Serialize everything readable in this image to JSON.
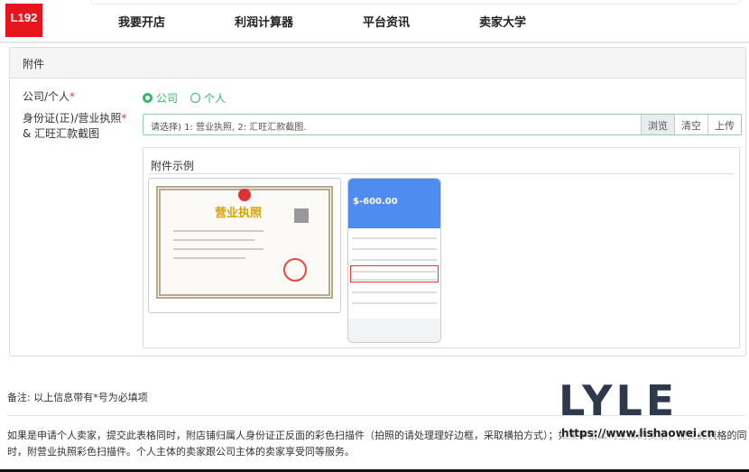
{
  "logo": {
    "text": "L192"
  },
  "nav": [
    "我要开店",
    "利润计算器",
    "平台资讯",
    "卖家大学"
  ],
  "panel": {
    "title": "附件"
  },
  "form": {
    "type_label": "公司/个人",
    "type_options": [
      "公司",
      "个人"
    ],
    "type_selected": "公司",
    "file_label_1": "身份证(正)/营业执照",
    "file_label_2": "& 汇旺汇款截图",
    "file_placeholder": "请选择) 1: 营业执照, 2: 汇旺汇款截图.",
    "browse": "浏览",
    "clear": "清空",
    "upload": "上传",
    "required_mark": "*"
  },
  "example": {
    "title": "附件示例",
    "cert_title": "营业执照",
    "phone_amount": "$-600.00"
  },
  "note": "备注: 以上信息带有*号为必填项",
  "paragraph": "如果是申请个人卖家，提交此表格同时，附店铺归属人身份证正反面的彩色扫描件（拍照的请处理理好边框，采取横拍方式）；如果申请公司主体的卖家，提交此表格的同时，附营业执照彩色扫描件。个人主体的卖家跟公司主体的卖家享受同等服务。",
  "watermark": {
    "text": "LYLE",
    "url": "https://www.lishaowei.cn"
  },
  "colors": {
    "accent": "#3cb46e",
    "logo": "#e8141b"
  }
}
